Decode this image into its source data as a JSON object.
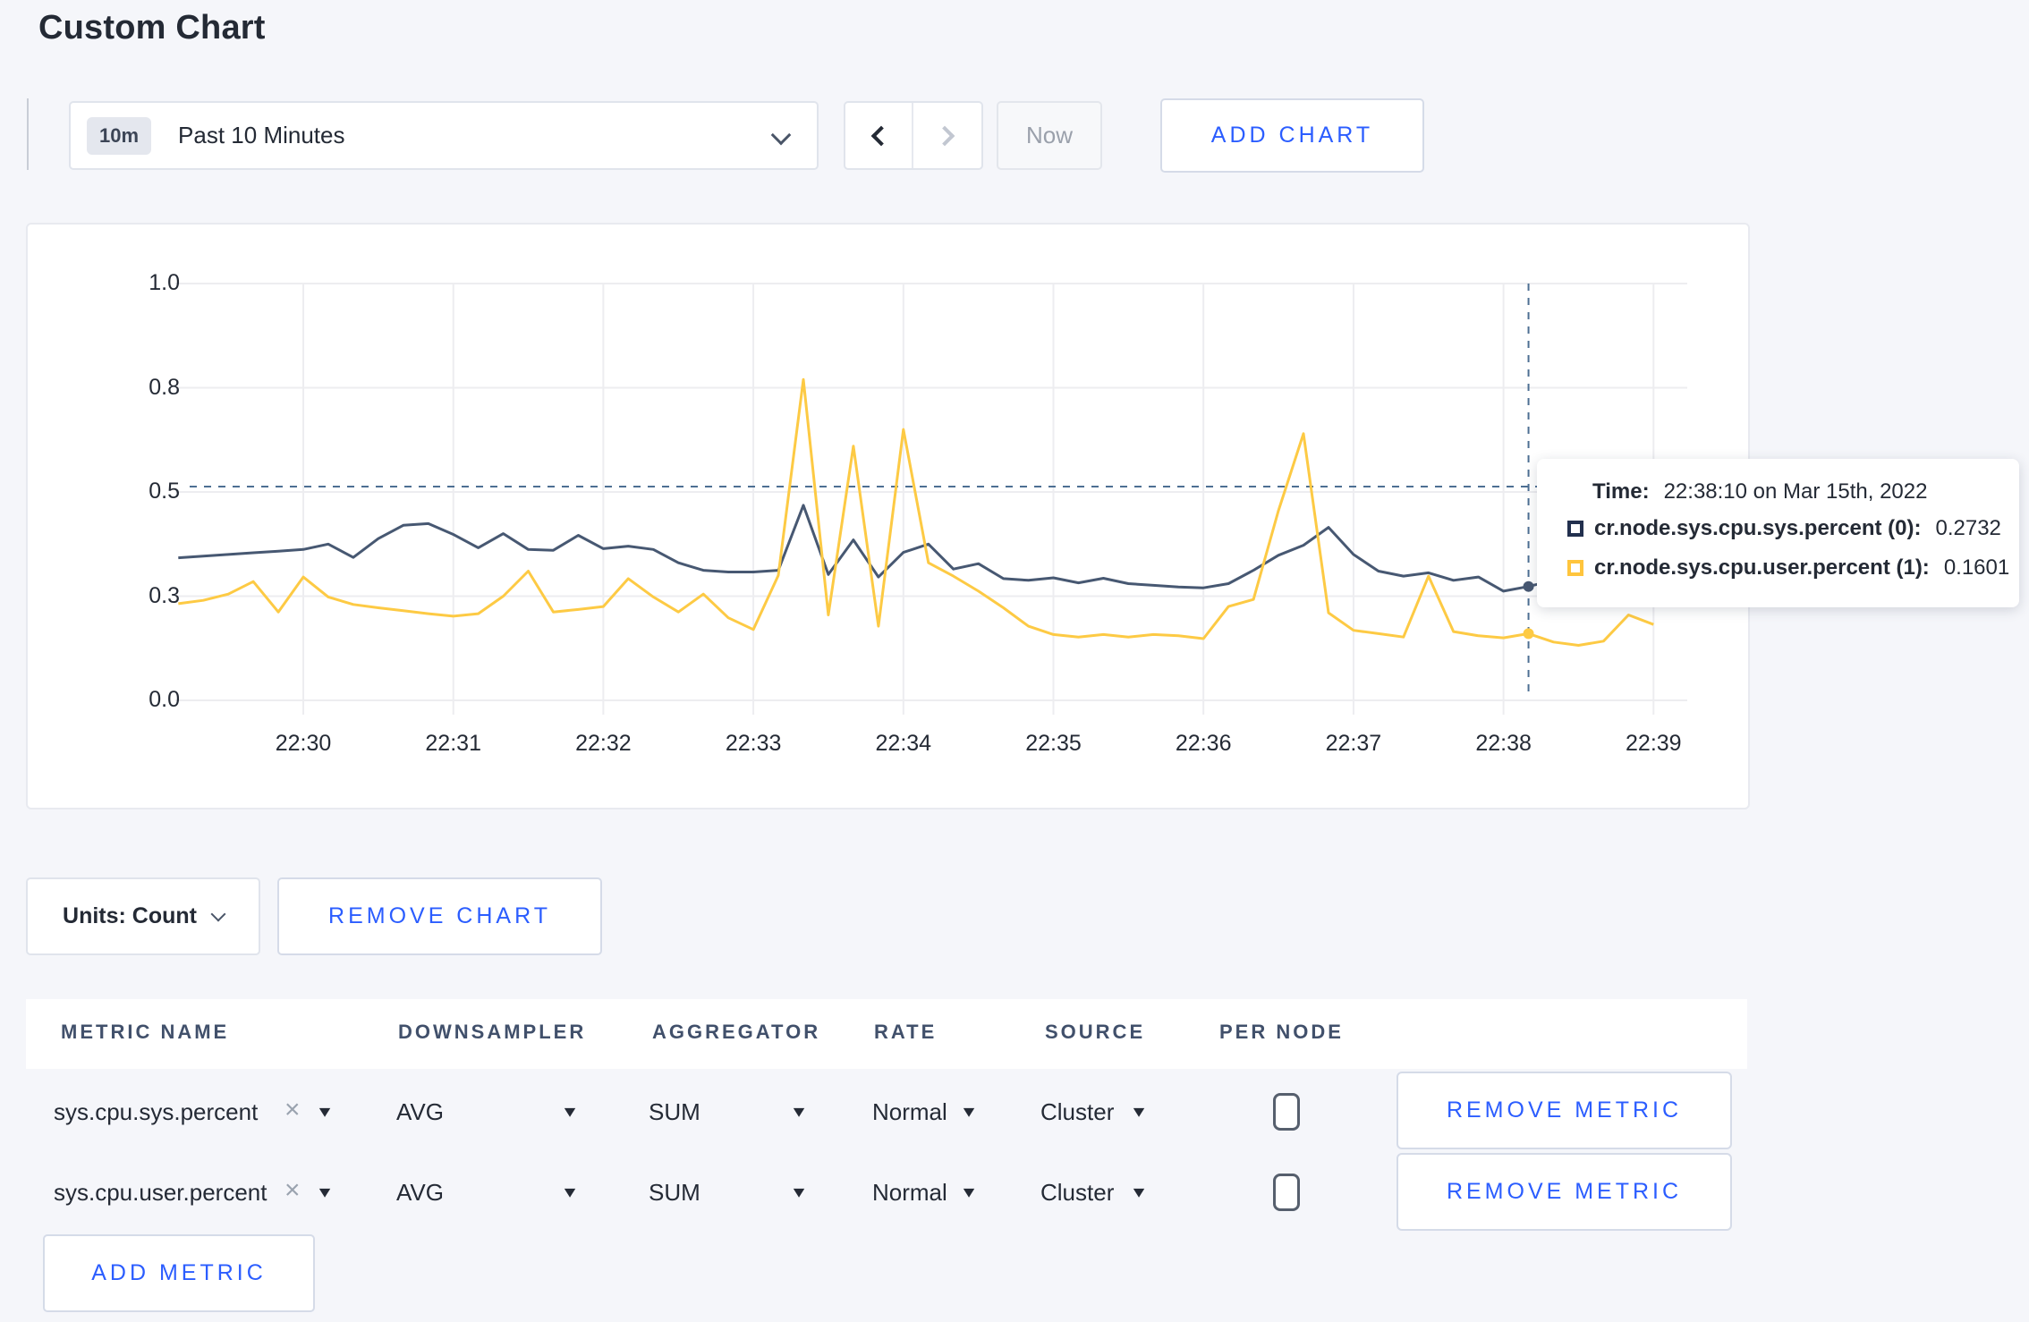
{
  "page": {
    "title": "Custom Chart"
  },
  "colors": {
    "accent_blue": "#2b5dff",
    "series_sys": "#475872",
    "series_user": "#fdca44",
    "swatch_sys": "#22304e",
    "swatch_user": "#ffc53d",
    "grid": "#ededf0",
    "crosshair": "#4d6f93"
  },
  "toolbar": {
    "range_badge": "10m",
    "range_label": "Past 10 Minutes",
    "now_label": "Now",
    "add_chart_label": "ADD CHART"
  },
  "chart": {
    "tooltip": {
      "time_label": "Time:",
      "time_value": "22:38:10 on Mar 15th, 2022",
      "series": [
        {
          "name": "cr.node.sys.cpu.sys.percent (0):",
          "value": "0.2732",
          "color": "#22304e"
        },
        {
          "name": "cr.node.sys.cpu.user.percent (1):",
          "value": "0.1601",
          "color": "#ffc53d"
        }
      ]
    }
  },
  "chart_data": {
    "type": "line",
    "title": "",
    "xlabel": "",
    "ylabel": "",
    "ylim": [
      0,
      1
    ],
    "grid": true,
    "legend_position": "tooltip",
    "x_start_time": "22:29:10",
    "x_interval_seconds": 10,
    "x_tick_labels": [
      "22:30",
      "22:31",
      "22:32",
      "22:33",
      "22:34",
      "22:35",
      "22:36",
      "22:37",
      "22:38",
      "22:39"
    ],
    "y_ticks": [
      {
        "value": 0.0,
        "label": "0.0"
      },
      {
        "value": 0.25,
        "label": "0.3"
      },
      {
        "value": 0.5,
        "label": "0.5"
      },
      {
        "value": 0.75,
        "label": "0.8"
      },
      {
        "value": 1.0,
        "label": "1.0"
      }
    ],
    "crosshair": {
      "x_minute": 8.1667,
      "y_value": 0.513,
      "time": "22:38:10"
    },
    "hover_points": [
      {
        "series": 0,
        "value": 0.2732
      },
      {
        "series": 1,
        "value": 0.1601
      }
    ],
    "series": [
      {
        "name": "cr.node.sys.cpu.sys.percent",
        "color": "#475872",
        "values": [
          0.342,
          0.346,
          0.35,
          0.354,
          0.358,
          0.362,
          0.375,
          0.343,
          0.388,
          0.42,
          0.424,
          0.398,
          0.366,
          0.4,
          0.362,
          0.36,
          0.396,
          0.364,
          0.37,
          0.362,
          0.33,
          0.312,
          0.308,
          0.308,
          0.312,
          0.468,
          0.302,
          0.385,
          0.296,
          0.355,
          0.375,
          0.315,
          0.328,
          0.292,
          0.288,
          0.294,
          0.282,
          0.293,
          0.28,
          0.276,
          0.272,
          0.27,
          0.28,
          0.312,
          0.348,
          0.372,
          0.415,
          0.35,
          0.31,
          0.298,
          0.306,
          0.288,
          0.296,
          0.262,
          0.2732,
          0.288,
          0.31,
          0.295,
          0.286,
          0.298
        ]
      },
      {
        "name": "cr.node.sys.cpu.user.percent",
        "color": "#fdca44",
        "values": [
          0.232,
          0.24,
          0.255,
          0.285,
          0.212,
          0.296,
          0.248,
          0.23,
          0.222,
          0.215,
          0.208,
          0.202,
          0.208,
          0.25,
          0.31,
          0.212,
          0.218,
          0.225,
          0.292,
          0.248,
          0.212,
          0.255,
          0.198,
          0.17,
          0.3,
          0.77,
          0.205,
          0.61,
          0.178,
          0.65,
          0.33,
          0.298,
          0.262,
          0.222,
          0.178,
          0.158,
          0.152,
          0.158,
          0.152,
          0.158,
          0.155,
          0.148,
          0.225,
          0.242,
          0.455,
          0.64,
          0.21,
          0.168,
          0.16,
          0.152,
          0.298,
          0.165,
          0.155,
          0.15,
          0.1601,
          0.14,
          0.132,
          0.142,
          0.205,
          0.182
        ]
      }
    ]
  },
  "units_bar": {
    "units_label": "Units: Count",
    "remove_chart_label": "REMOVE CHART"
  },
  "metrics_table": {
    "headers": [
      "METRIC NAME",
      "DOWNSAMPLER",
      "AGGREGATOR",
      "RATE",
      "SOURCE",
      "PER NODE"
    ],
    "remove_metric_label": "REMOVE METRIC",
    "add_metric_label": "ADD METRIC",
    "close_glyph": "×",
    "caret_glyph": "▾",
    "rows": [
      {
        "metric": "sys.cpu.sys.percent",
        "downsampler": "AVG",
        "aggregator": "SUM",
        "rate": "Normal",
        "source": "Cluster",
        "per_node": false
      },
      {
        "metric": "sys.cpu.user.percent",
        "downsampler": "AVG",
        "aggregator": "SUM",
        "rate": "Normal",
        "source": "Cluster",
        "per_node": false
      }
    ]
  }
}
